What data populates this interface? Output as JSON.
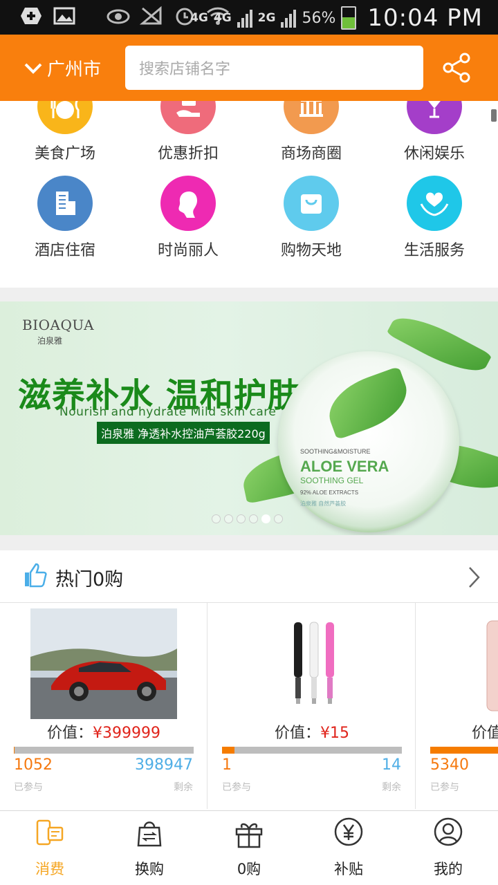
{
  "status_bar": {
    "network_1": "4G",
    "network_2": "4G",
    "network_3": "2G",
    "battery": "56%",
    "time": "10:04 PM"
  },
  "header": {
    "city": "广州市",
    "search_placeholder": "搜索店铺名字",
    "bg_color": "#f97f0d"
  },
  "categories": [
    {
      "label": "美食广场",
      "icon": "dining-icon",
      "color": "#f9b51a"
    },
    {
      "label": "优惠折扣",
      "icon": "discount-hand-icon",
      "color": "#ef6b7b"
    },
    {
      "label": "商场商圈",
      "icon": "mall-icon",
      "color": "#f29a4f"
    },
    {
      "label": "休闲娱乐",
      "icon": "cocktail-icon",
      "color": "#a43ec9"
    },
    {
      "label": "酒店住宿",
      "icon": "hotel-building-icon",
      "color": "#4a86c8"
    },
    {
      "label": "时尚丽人",
      "icon": "woman-profile-icon",
      "color": "#ee2ab2"
    },
    {
      "label": "购物天地",
      "icon": "shopping-bag-icon",
      "color": "#5fcbed"
    },
    {
      "label": "生活服务",
      "icon": "heart-hands-icon",
      "color": "#1fc7e8"
    }
  ],
  "banner": {
    "brand_en": "BIOAQUA",
    "brand_cn": "泊泉雅",
    "title": "滋养补水 温和护肤",
    "subtitle": "Nourish and hydrate Mild skin care",
    "tag": "泊泉雅 净透补水控油芦荟胶220g",
    "jar_line1": "SOOTHING&MOISTURE",
    "jar_line2": "ALOE VERA",
    "jar_line3": "SOOTHING GEL",
    "jar_line4": "92% ALOE EXTRACTS",
    "jar_line5": "泊泉雅 自然芦荟胶",
    "slide_count": 6,
    "active_slide": 5
  },
  "hot": {
    "title": "热门0购",
    "price_prefix": "价值：",
    "joined_label": "已参与",
    "remain_label": "剩余",
    "items": [
      {
        "price": "¥399999",
        "joined": "1052",
        "remain": "398947",
        "progress": 0.003,
        "image": "red-car"
      },
      {
        "price": "¥15",
        "joined": "1",
        "remain": "14",
        "progress": 0.07,
        "image": "usb-lamps"
      },
      {
        "price": "",
        "joined": "5340",
        "remain": "",
        "progress": 1.0,
        "image": "phone"
      }
    ]
  },
  "tabs": [
    {
      "label": "消费",
      "icon": "phone-card-icon",
      "active": true
    },
    {
      "label": "换购",
      "icon": "exchange-bag-icon",
      "active": false
    },
    {
      "label": "0购",
      "icon": "gift-box-icon",
      "active": false
    },
    {
      "label": "补贴",
      "icon": "yuan-coin-icon",
      "active": false
    },
    {
      "label": "我的",
      "icon": "user-profile-icon",
      "active": false
    }
  ]
}
